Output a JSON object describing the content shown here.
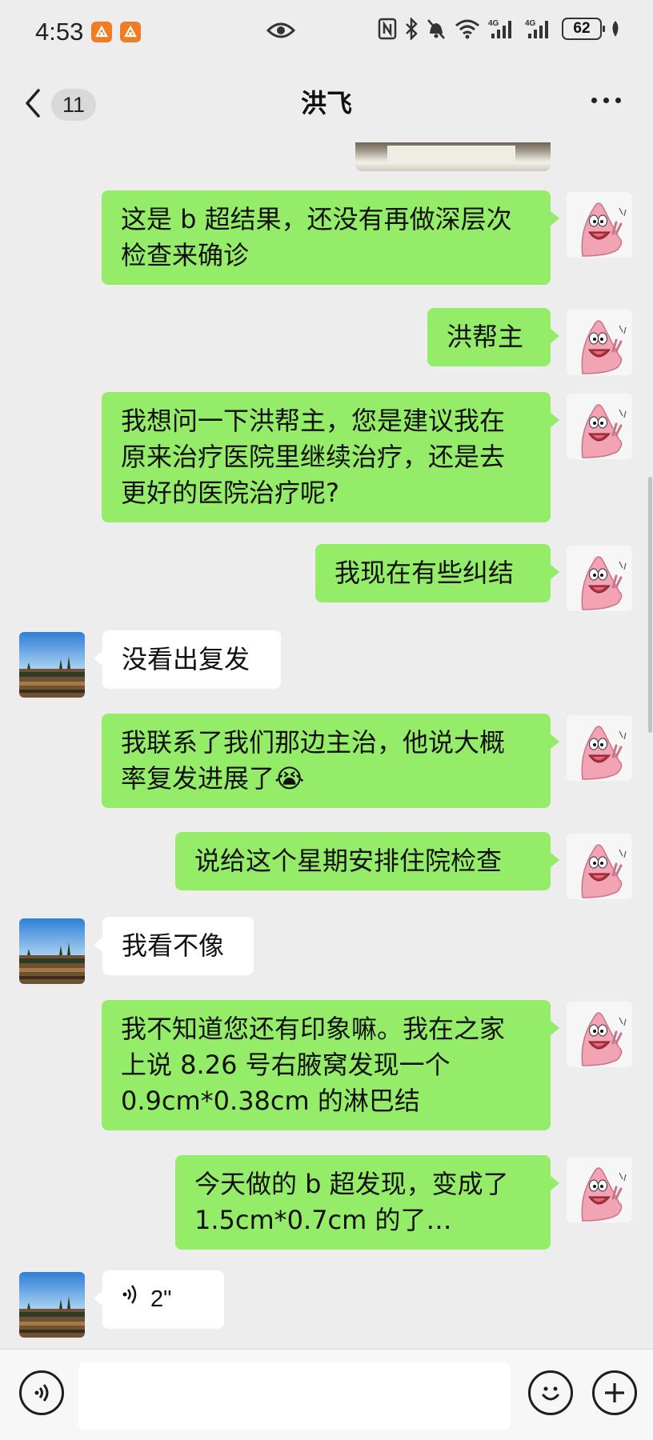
{
  "status_bar": {
    "time": "4:53",
    "battery": "62"
  },
  "header": {
    "back_count": "11",
    "title": "洪飞"
  },
  "messages": [
    {
      "from": "me",
      "text_lines": [
        "这是 b 超结果，还没有再做深层次",
        "检查来确诊"
      ]
    },
    {
      "from": "me",
      "text_lines": [
        "洪帮主"
      ]
    },
    {
      "from": "me",
      "text_lines": [
        "我想问一下洪帮主，您是建议我在",
        "原来治疗医院里继续治疗，还是去",
        "更好的医院治疗呢?"
      ]
    },
    {
      "from": "me",
      "text_lines": [
        "我现在有些纠结"
      ]
    },
    {
      "from": "them",
      "text_lines": [
        "没看出复发"
      ]
    },
    {
      "from": "me",
      "text_lines": [
        "我联系了我们那边主治，他说大概",
        "率复发进展了😭"
      ]
    },
    {
      "from": "me",
      "text_lines": [
        "说给这个星期安排住院检查"
      ]
    },
    {
      "from": "them",
      "text_lines": [
        "我看不像"
      ]
    },
    {
      "from": "me",
      "text_lines": [
        "我不知道您还有印象嘛。我在之家",
        "上说 8.26 号右腋窝发现一个",
        "0.9cm*0.38cm 的淋巴结"
      ]
    },
    {
      "from": "me",
      "text_lines": [
        "今天做的 b 超发现，变成了",
        "1.5cm*0.7cm 的了…"
      ]
    },
    {
      "from": "them",
      "type": "voice",
      "duration": "2\""
    }
  ],
  "icons": {
    "back": "chevron-left-icon",
    "more": "more-dots-icon",
    "voice_toggle": "voice-icon",
    "emoji": "emoji-icon",
    "add": "plus-icon"
  },
  "colors": {
    "my_bubble": "#95ec69",
    "their_bubble": "#ffffff",
    "background": "#ededed"
  }
}
